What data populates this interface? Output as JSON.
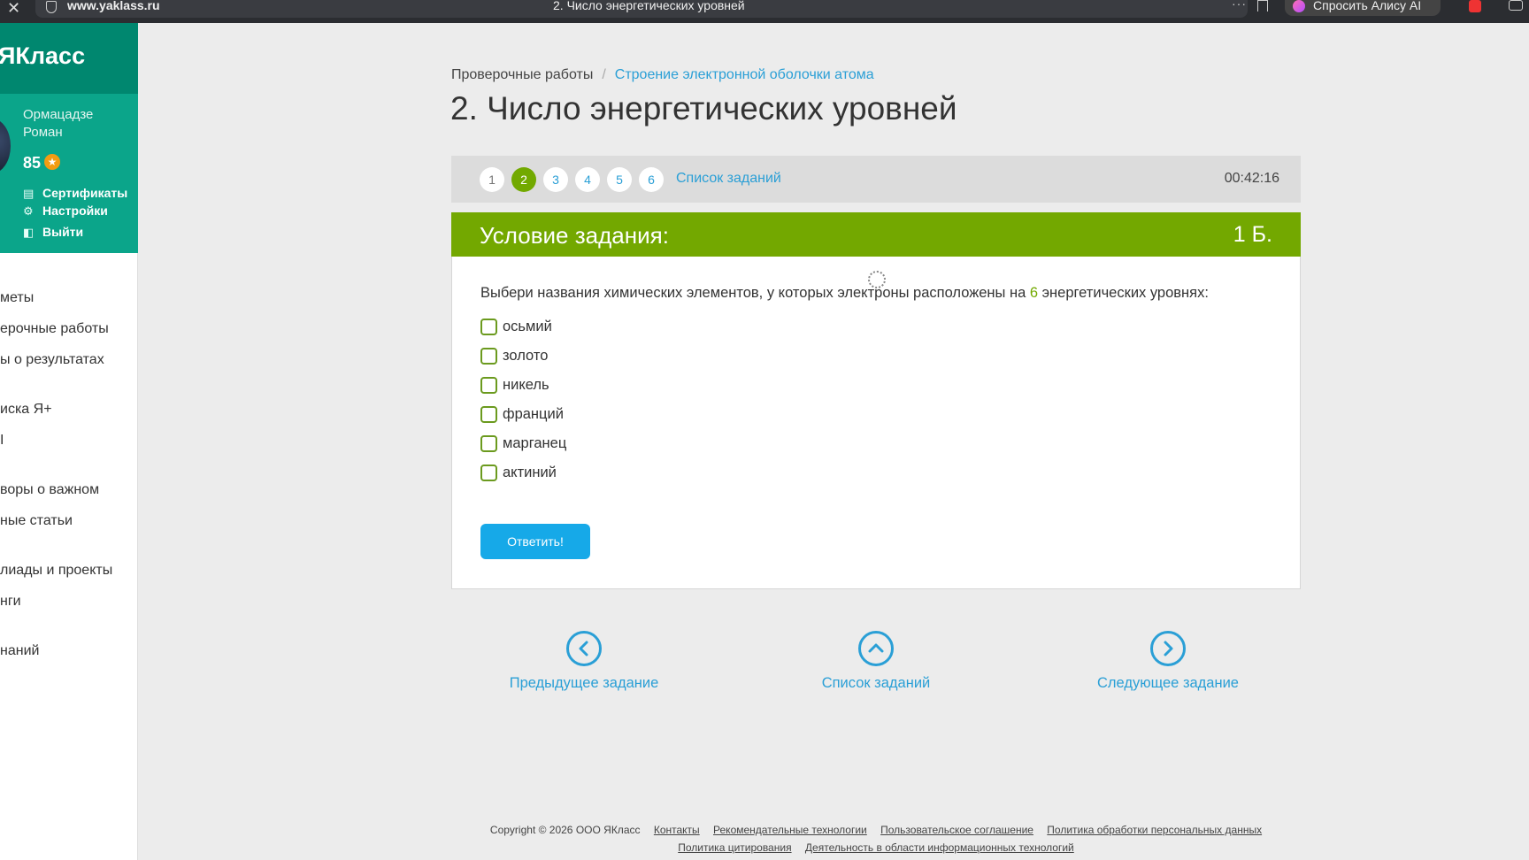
{
  "browser": {
    "close": "✕",
    "url": "www.yaklass.ru",
    "tab_title": "2. Число энергетических уровней",
    "menu": "···",
    "alice_label": "Спросить Алису AI"
  },
  "sidebar": {
    "brand": "ЯКласс",
    "user_name": "Ормацадзе Роман",
    "points": "85",
    "links": {
      "certificates": "Сертификаты",
      "settings": "Настройки",
      "logout": "Выйти"
    },
    "nav": [
      "меты",
      "ерочные работы",
      "ы о результатах",
      "иска Я+",
      "І",
      "воры о важном",
      "ные статьи",
      "лиады и проекты",
      "нги",
      "наний"
    ]
  },
  "breadcrumb": {
    "first": "Проверочные работы",
    "separator": "/",
    "link": "Строение электронной оболочки атома"
  },
  "page_title": "2. Число энергетических уровней",
  "task_nav": {
    "pills": [
      "1",
      "2",
      "3",
      "4",
      "5",
      "6"
    ],
    "list_link": "Список заданий",
    "timer": "00:42:16"
  },
  "card": {
    "title": "Условие задания:",
    "points": "1 Б.",
    "question_before": "Выбери названия химических элементов, у которых электроны расположены на ",
    "question_highlight": "6",
    "question_after": " энергетических уровнях:",
    "options": [
      "осьмий",
      "золото",
      "никель",
      "франций",
      "марганец",
      "актиний"
    ],
    "answer_button": "Ответить!"
  },
  "bottom_nav": {
    "prev": "Предыдущее задание",
    "list": "Список заданий",
    "next": "Следующее задание"
  },
  "footer": {
    "copyright": "Copyright © 2026 ООО ЯКласс",
    "links_row1": [
      "Контакты",
      "Рекомендательные технологии",
      "Пользовательское соглашение",
      "Политика обработки персональных данных"
    ],
    "links_row2": [
      "Политика цитирования",
      "Деятельность в области информационных технологий"
    ]
  },
  "colors": {
    "brand_dark": "#00876f",
    "brand": "#0ba58a",
    "accent_green": "#73a800",
    "link_blue": "#2a9fd6",
    "button_blue": "#16a9e8"
  }
}
